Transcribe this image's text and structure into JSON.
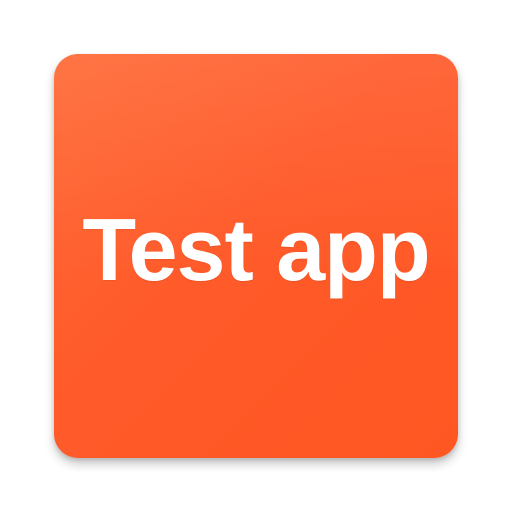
{
  "app_icon": {
    "title": "Test app",
    "colors": {
      "background": "#ff5722",
      "text": "#ffffff"
    }
  }
}
